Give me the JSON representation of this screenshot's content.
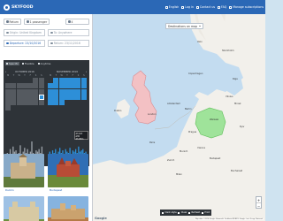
{
  "app": {
    "name": "SKYFOOD"
  },
  "topnav": [
    {
      "label": "English",
      "icon": "flag-icon"
    },
    {
      "label": "Log in",
      "icon": "login-icon"
    },
    {
      "label": "Contact us",
      "icon": "mail-icon"
    },
    {
      "label": "FAQ",
      "icon": "question-icon"
    },
    {
      "label": "Manage subscriptions",
      "icon": "bell-icon"
    }
  ],
  "filters": {
    "mode": "Return",
    "passengers": "1 passenger",
    "from": "Origin: United Kingdom",
    "to": "To: Anywhere",
    "depart": "Departure: 23/10/2016",
    "return": "Return: 23/11/2016"
  },
  "calendar": {
    "toolbar": [
      "Specific",
      "Flexible",
      "Anytime"
    ],
    "left_month": "OCTOBER 2016",
    "right_month": "NOVEMBER 2016",
    "weekdays": [
      "M",
      "T",
      "W",
      "T",
      "F",
      "S",
      "S"
    ],
    "tooltip": [
      "23 Oct",
      "£39",
      "2h 05m"
    ],
    "histogram": {
      "left": [
        6,
        9,
        7,
        12,
        8,
        14,
        10,
        11,
        7,
        9,
        15,
        8,
        10,
        13,
        9,
        12,
        7,
        10,
        18,
        9,
        8,
        11,
        10,
        12,
        9,
        14,
        8
      ],
      "right": [
        8,
        10,
        7,
        11,
        9,
        12,
        8,
        10,
        13,
        9,
        11,
        8,
        12,
        10,
        9,
        13,
        8,
        11,
        10,
        12,
        9,
        14,
        10,
        11,
        12,
        9,
        10
      ]
    }
  },
  "results": [
    {
      "caption": "Dublin"
    },
    {
      "caption": "Budapest"
    },
    {
      "caption": ""
    },
    {
      "caption": ""
    }
  ],
  "map": {
    "button": "Destinations on map",
    "zoom_in": "+",
    "zoom_out": "−",
    "tools": [
      "Dark style",
      "Clear",
      "Refresh",
      "Print"
    ],
    "attribution": "Map data ©2016 Google, Basarsoft, GeoBasis-DE/BKG, Google, Inst. Geogr. Nacional",
    "google": "Google",
    "cities": [
      "Oslo",
      "Stockholm",
      "Copenhagen",
      "Dublin",
      "London",
      "Amsterdam",
      "Berlin",
      "Warsaw",
      "Paris",
      "Prague",
      "Vienna",
      "Budapest",
      "Munich",
      "Zurich",
      "Milan",
      "Kyiv",
      "Minsk",
      "Riga",
      "Vilnius",
      "Bucharest"
    ]
  },
  "colors": {
    "topbar": "#2b68b6",
    "calendar_bg": "#2e3338",
    "selected": "#2d8fd8",
    "uk_region": "#f3c1c4",
    "poland_region": "#9fe39a"
  }
}
